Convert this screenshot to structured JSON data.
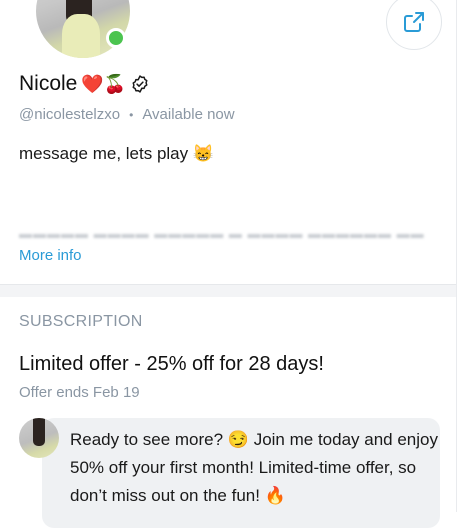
{
  "profile": {
    "name": "Nicole",
    "name_emojis": "❤️🍒",
    "handle": "@nicolestelzxo",
    "separator": "•",
    "status": "Available now",
    "bio": "message me, lets play 😸",
    "more_info_label": "More info"
  },
  "subscription": {
    "section_title": "SUBSCRIPTION",
    "offer_title": "Limited offer - 25% off for 28 days!",
    "offer_ends": "Offer ends Feb 19",
    "message": "Ready to see more? 😏 Join me today and enjoy 50% off your first month! Limited-time offer, so don’t miss out on the fun! 🔥"
  },
  "icons": {
    "share": "share-icon",
    "verified": "verified-badge-icon",
    "online": "online-status-indicator"
  },
  "colors": {
    "accent": "#2a9bd6",
    "muted": "#8a96a3",
    "online": "#4cc44f"
  }
}
